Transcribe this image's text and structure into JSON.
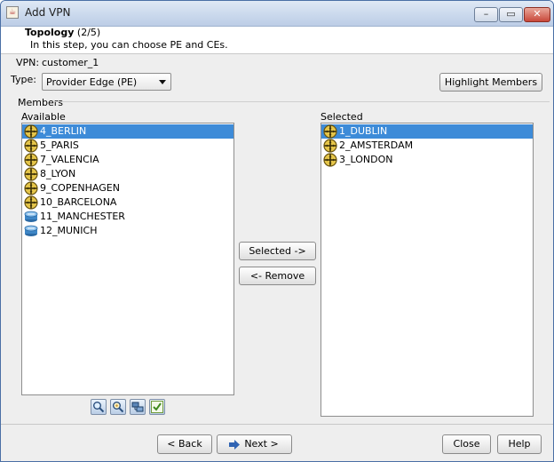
{
  "window": {
    "title": "Add VPN",
    "minimize": "–",
    "maximize": "▭",
    "close": "✕"
  },
  "header": {
    "title": "Topology",
    "step": "(2/5)",
    "description": "In this step, you can choose PE and CEs."
  },
  "form": {
    "vpn_label": "VPN:",
    "vpn_value": "customer_1",
    "type_label": "Type:",
    "type_value": "Provider Edge (PE)",
    "highlight_button": "Highlight Members"
  },
  "members": {
    "group_label": "Members",
    "available_label": "Available",
    "selected_label": "Selected",
    "available": [
      {
        "label": "4_BERLIN",
        "icon": "pe-router-icon",
        "selected": true
      },
      {
        "label": "5_PARIS",
        "icon": "pe-router-icon",
        "selected": false
      },
      {
        "label": "7_VALENCIA",
        "icon": "pe-router-icon",
        "selected": false
      },
      {
        "label": "8_LYON",
        "icon": "pe-router-icon",
        "selected": false
      },
      {
        "label": "9_COPENHAGEN",
        "icon": "pe-router-icon",
        "selected": false
      },
      {
        "label": "10_BARCELONA",
        "icon": "pe-router-icon",
        "selected": false
      },
      {
        "label": "11_MANCHESTER",
        "icon": "ce-router-icon",
        "selected": false
      },
      {
        "label": "12_MUNICH",
        "icon": "ce-router-icon",
        "selected": false
      }
    ],
    "selected": [
      {
        "label": "1_DUBLIN",
        "icon": "pe-router-icon",
        "selected": true
      },
      {
        "label": "2_AMSTERDAM",
        "icon": "pe-router-icon",
        "selected": false
      },
      {
        "label": "3_LONDON",
        "icon": "pe-router-icon",
        "selected": false
      }
    ],
    "add_button": "Selected ->",
    "remove_button": "<- Remove",
    "tools": [
      "find-icon",
      "find-node-icon",
      "network-icon",
      "check-icon"
    ]
  },
  "footer": {
    "back": "< Back",
    "next": "Next >",
    "close": "Close",
    "help": "Help"
  },
  "colors": {
    "selection": "#3d8bd8",
    "titlebar": "#c9d8ec"
  }
}
